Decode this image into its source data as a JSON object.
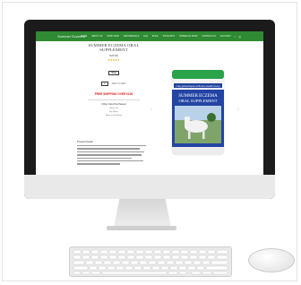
{
  "site": {
    "logo": "Summer Eczema",
    "nav": [
      "HOME",
      "ABOUT US",
      "SHOP NOW",
      "TESTIMONIALS",
      "FAQ",
      "BLOG",
      "STOCKISTS",
      "HORSE OIL SHOP",
      "CONTACT US",
      "ACCOUNT"
    ],
    "icons": [
      "search-icon",
      "cart-icon"
    ]
  },
  "product": {
    "title": "SUMMER ECZEMA ORAL SUPPLEMENT",
    "price": "€29.99",
    "rating_stars": "★★★★★",
    "size": "500g",
    "quantity": "1",
    "add_to_cart": "ADD TO CART",
    "free_shipping": "FREE SHIPPING OVER €100",
    "other_title": "Other Also Purchased",
    "other_items": [
      "Horse Oil",
      "Fly Spray",
      "Mane & Tail Spray"
    ],
    "desc_title": "Product Detail"
  },
  "jar": {
    "band_text": "Fully global Equine & Bovine Health Group",
    "label_line1": "SUMMER ECZEMA",
    "label_line2": "ORAL SUPPLEMENT",
    "lid_color": "#2aa34a",
    "label_color": "#1f3f9e"
  },
  "colors": {
    "nav": "#2e8a33",
    "accent": "#e01a1a"
  }
}
